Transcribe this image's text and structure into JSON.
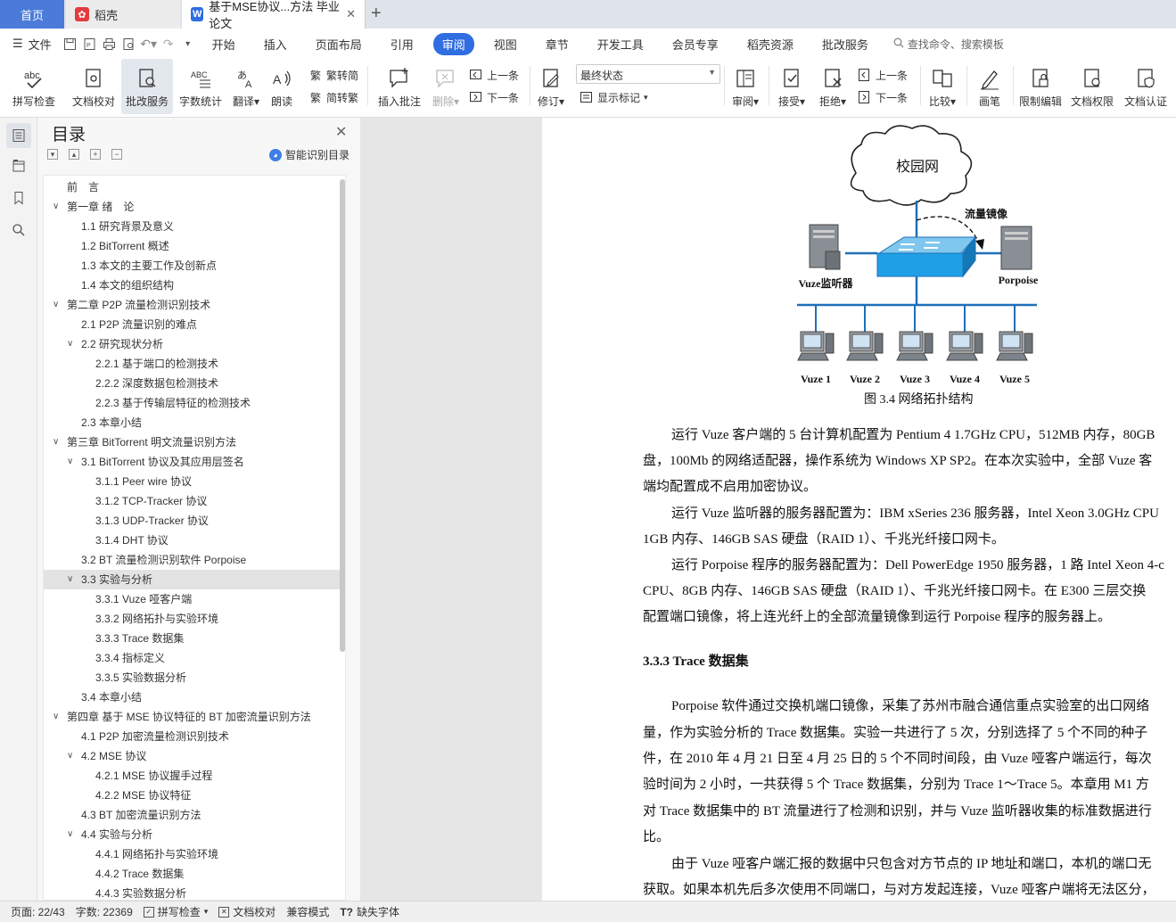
{
  "tabs": [
    {
      "label": "首页"
    },
    {
      "label": "稻壳"
    },
    {
      "label": "基于MSE协议...方法 毕业论文"
    }
  ],
  "menu": {
    "file": "文件",
    "items": [
      "开始",
      "插入",
      "页面布局",
      "引用",
      "审阅",
      "视图",
      "章节",
      "开发工具",
      "会员专享",
      "稻壳资源",
      "批改服务"
    ],
    "active": "审阅",
    "search": "查找命令、搜索模板"
  },
  "ribbon": {
    "spell": "拼写检查",
    "proofread": "文档校对",
    "correction": "批改服务",
    "wordcount": "字数统计",
    "translate": "翻译",
    "read": "朗读",
    "trad": "繁转简",
    "simp": "简转繁",
    "insert_comment": "插入批注",
    "delete": "删除",
    "prev": "上一条",
    "next": "下一条",
    "revise": "修订",
    "state": "最终状态",
    "show_marks": "显示标记",
    "review": "审阅",
    "accept": "接受",
    "reject": "拒绝",
    "prev2": "上一条",
    "next2": "下一条",
    "compare": "比较",
    "pen": "画笔",
    "restrict": "限制编辑",
    "rights": "文档权限",
    "auth": "文档认证"
  },
  "toc": {
    "title": "目录",
    "ai": "智能识别目录",
    "items": [
      {
        "text": "前　言",
        "level": 0,
        "arrow": ""
      },
      {
        "text": "第一章  绪　论",
        "level": 0,
        "arrow": "v"
      },
      {
        "text": "1.1  研究背景及意义",
        "level": 1,
        "arrow": ""
      },
      {
        "text": "1.2  BitTorrent 概述",
        "level": 1,
        "arrow": ""
      },
      {
        "text": "1.3  本文的主要工作及创新点",
        "level": 1,
        "arrow": ""
      },
      {
        "text": "1.4  本文的组织结构",
        "level": 1,
        "arrow": ""
      },
      {
        "text": "第二章  P2P 流量检测识别技术",
        "level": 0,
        "arrow": "v"
      },
      {
        "text": "2.1  P2P 流量识别的难点",
        "level": 1,
        "arrow": ""
      },
      {
        "text": "2.2  研究现状分析",
        "level": 1,
        "arrow": "v"
      },
      {
        "text": "2.2.1  基于端口的检测技术",
        "level": 2,
        "arrow": ""
      },
      {
        "text": "2.2.2  深度数据包检测技术",
        "level": 2,
        "arrow": ""
      },
      {
        "text": "2.2.3  基于传输层特征的检测技术",
        "level": 2,
        "arrow": ""
      },
      {
        "text": "2.3  本章小结",
        "level": 1,
        "arrow": ""
      },
      {
        "text": "第三章  BitTorrent 明文流量识别方法",
        "level": 0,
        "arrow": "v"
      },
      {
        "text": "3.1  BitTorrent 协议及其应用层签名",
        "level": 1,
        "arrow": "v"
      },
      {
        "text": "3.1.1  Peer wire 协议",
        "level": 2,
        "arrow": ""
      },
      {
        "text": "3.1.2  TCP-Tracker 协议",
        "level": 2,
        "arrow": ""
      },
      {
        "text": "3.1.3  UDP-Tracker 协议",
        "level": 2,
        "arrow": ""
      },
      {
        "text": "3.1.4  DHT 协议",
        "level": 2,
        "arrow": ""
      },
      {
        "text": "3.2  BT 流量检测识别软件 Porpoise",
        "level": 1,
        "arrow": ""
      },
      {
        "text": "3.3  实验与分析",
        "level": 1,
        "arrow": "v",
        "selected": true
      },
      {
        "text": "3.3.1  Vuze 哑客户端",
        "level": 2,
        "arrow": ""
      },
      {
        "text": "3.3.2  网络拓扑与实验环境",
        "level": 2,
        "arrow": ""
      },
      {
        "text": "3.3.3  Trace 数据集",
        "level": 2,
        "arrow": ""
      },
      {
        "text": "3.3.4  指标定义",
        "level": 2,
        "arrow": ""
      },
      {
        "text": "3.3.5  实验数据分析",
        "level": 2,
        "arrow": ""
      },
      {
        "text": "3.4  本章小结",
        "level": 1,
        "arrow": ""
      },
      {
        "text": "第四章  基于 MSE 协议特征的 BT 加密流量识别方法",
        "level": 0,
        "arrow": "v"
      },
      {
        "text": "4.1  P2P 加密流量检测识别技术",
        "level": 1,
        "arrow": ""
      },
      {
        "text": "4.2  MSE 协议",
        "level": 1,
        "arrow": "v"
      },
      {
        "text": "4.2.1  MSE 协议握手过程",
        "level": 2,
        "arrow": ""
      },
      {
        "text": "4.2.2  MSE 协议特征",
        "level": 2,
        "arrow": ""
      },
      {
        "text": "4.3  BT 加密流量识别方法",
        "level": 1,
        "arrow": ""
      },
      {
        "text": "4.4  实验与分析",
        "level": 1,
        "arrow": "v"
      },
      {
        "text": "4.4.1  网络拓扑与实验环境",
        "level": 2,
        "arrow": ""
      },
      {
        "text": "4.4.2  Trace 数据集",
        "level": 2,
        "arrow": ""
      },
      {
        "text": "4.4.3  实验数据分析",
        "level": 2,
        "arrow": ""
      }
    ]
  },
  "figure": {
    "cloud": "校园网",
    "mirror": "流量镜像",
    "monitor": "Vuze监听器",
    "porpoise": "Porpoise",
    "clients": [
      "Vuze 1",
      "Vuze 2",
      "Vuze 3",
      "Vuze 4",
      "Vuze 5"
    ],
    "caption": "图 3.4  网络拓扑结构"
  },
  "doc": {
    "lines": [
      "运行 Vuze 客户端的 5 台计算机配置为 Pentium 4 1.7GHz CPU，512MB 内存，80GB",
      "盘，100Mb 的网络适配器，操作系统为 Windows XP SP2。在本次实验中，全部 Vuze 客",
      "端均配置成不启用加密协议。",
      "运行 Vuze 监听器的服务器配置为：IBM xSeries 236 服务器，Intel Xeon 3.0GHz CPU",
      "1GB 内存、146GB SAS 硬盘（RAID 1）、千兆光纤接口网卡。",
      "运行 Porpoise 程序的服务器配置为：Dell PowerEdge 1950 服务器，1 路 Intel Xeon 4-c",
      "CPU、8GB 内存、146GB SAS 硬盘（RAID 1）、千兆光纤接口网卡。在 E300 三层交换",
      "配置端口镜像，将上连光纤上的全部流量镜像到运行 Porpoise 程序的服务器上。",
      "Porpoise 软件通过交换机端口镜像，采集了苏州市融合通信重点实验室的出口网络",
      "量，作为实验分析的 Trace 数据集。实验一共进行了 5 次，分别选择了 5 个不同的种子",
      "件，在 2010 年 4 月 21 日至 4 月 25 日的 5 个不同时间段，由 Vuze 哑客户端运行，每次",
      "验时间为 2 小时，一共获得 5 个 Trace 数据集，分别为 Trace 1～Trace 5。本章用 M1 方",
      "对 Trace 数据集中的 BT 流量进行了检测和识别，并与 Vuze 监听器收集的标准数据进行",
      "比。",
      "由于 Vuze 哑客户端汇报的数据中只包含对方节点的 IP 地址和端口，本机的端口无",
      "获取。如果本机先后多次使用不同端口，与对方发起连接，Vuze 哑客户端将无法区分，"
    ],
    "heading": "3.3.3 Trace 数据集"
  },
  "status": {
    "page": "页面: 22/43",
    "words": "字数: 22369",
    "spell": "拼写检查",
    "proof": "文档校对",
    "compat": "兼容模式",
    "font": "缺失字体"
  }
}
